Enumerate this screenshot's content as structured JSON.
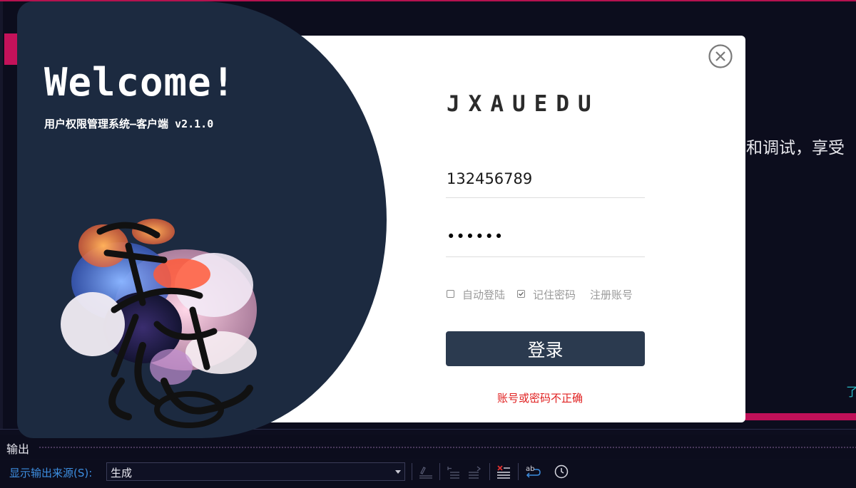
{
  "background": {
    "welcome_fragment": "和调试，享受",
    "link_fragment": "了"
  },
  "output_panel": {
    "title": "输出",
    "source_label": "显示输出来源(S):",
    "source_value": "生成",
    "toolbar_icons": [
      "find-in-output-icon",
      "previous-message-icon",
      "next-message-icon",
      "clear-all-icon",
      "word-wrap-icon",
      "timestamp-icon"
    ]
  },
  "login": {
    "welcome": "Welcome!",
    "subtitle": "用户权限管理系统—客户端 v2.1.0",
    "brand": "JXAUEDU",
    "username_value": "132456789",
    "password_value": "••••••",
    "auto_login_label": "自动登陆",
    "auto_login_checked": false,
    "remember_password_label": "记住密码",
    "remember_password_checked": true,
    "register_label": "注册账号",
    "login_button_label": "登录",
    "error_message": "账号或密码不正确",
    "artwork": "dream-calligraphy-artwork"
  },
  "colors": {
    "dialog_left_panel": "#1c2a40",
    "login_button": "#2b3a4f",
    "error": "#e02020",
    "ide_accent": "#c4125a",
    "source_label": "#3d8ee0"
  }
}
